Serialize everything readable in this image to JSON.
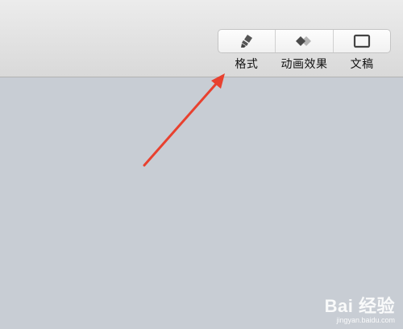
{
  "toolbar": {
    "buttons": [
      {
        "icon": "paintbrush-icon",
        "label": "格式"
      },
      {
        "icon": "animation-diamond-icon",
        "label": "动画效果"
      },
      {
        "icon": "document-window-icon",
        "label": "文稿"
      }
    ]
  },
  "annotation": {
    "color": "#e8412f"
  },
  "watermark": {
    "logo": "Bai 经验",
    "url": "jingyan.baidu.com"
  }
}
